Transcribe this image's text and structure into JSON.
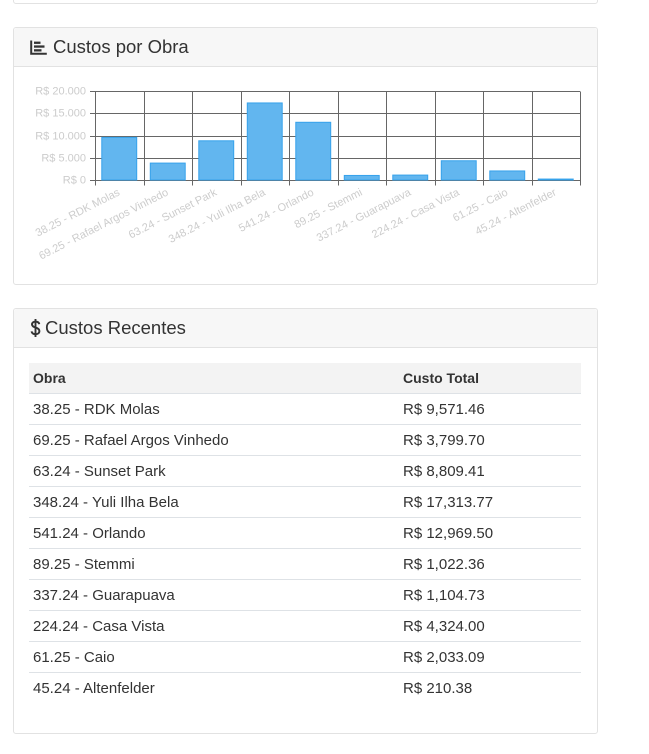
{
  "chart_card": {
    "title": "Custos por Obra",
    "icon": "bar-chart-icon"
  },
  "recent_costs_card": {
    "title": "Custos Recentes",
    "icon": "dollar-sign-icon",
    "columns": [
      "Obra",
      "Custo Total"
    ],
    "rows": [
      {
        "obra": "38.25 - RDK Molas",
        "custo_total": "R$ 9,571.46"
      },
      {
        "obra": "69.25 - Rafael Argos Vinhedo",
        "custo_total": "R$ 3,799.70"
      },
      {
        "obra": "63.24 - Sunset Park",
        "custo_total": "R$ 8,809.41"
      },
      {
        "obra": "348.24 - Yuli Ilha Bela",
        "custo_total": "R$ 17,313.77"
      },
      {
        "obra": "541.24 - Orlando",
        "custo_total": "R$ 12,969.50"
      },
      {
        "obra": "89.25 - Stemmi",
        "custo_total": "R$ 1,022.36"
      },
      {
        "obra": "337.24 - Guarapuava",
        "custo_total": "R$ 1,104.73"
      },
      {
        "obra": "224.24 - Casa Vista",
        "custo_total": "R$ 4,324.00"
      },
      {
        "obra": "61.25 - Caio",
        "custo_total": "R$ 2,033.09"
      },
      {
        "obra": "45.24 - Altenfelder",
        "custo_total": "R$ 210.38"
      }
    ]
  },
  "colors": {
    "bar_fill": "#62b6ef",
    "bar_border": "#36a2eb",
    "grid_line": "#666666",
    "tick_label": "#cccccc",
    "card_header_bg": "#f7f7f7",
    "table_header_bg": "#f3f3f3",
    "text": "#333333"
  },
  "chart_data": {
    "type": "bar",
    "categories": [
      "38.25 - RDK Molas",
      "69.25 - Rafael Argos Vinhedo",
      "63.24 - Sunset Park",
      "348.24 - Yuli Ilha Bela",
      "541.24 - Orlando",
      "89.25 - Stemmi",
      "337.24 - Guarapuava",
      "224.24 - Casa Vista",
      "61.25 - Caio",
      "45.24 - Altenfelder"
    ],
    "values": [
      9571.46,
      3799.7,
      8809.41,
      17313.77,
      12969.5,
      1022.36,
      1104.73,
      4324.0,
      2033.09,
      210.38
    ],
    "ylim": [
      0,
      20000
    ],
    "y_ticks": [
      0,
      5000,
      10000,
      15000,
      20000
    ],
    "y_tick_labels": [
      "R$ 0",
      "R$ 5.000",
      "R$ 10.000",
      "R$ 15.000",
      "R$ 20.000"
    ],
    "grid": true,
    "legend": "none"
  }
}
